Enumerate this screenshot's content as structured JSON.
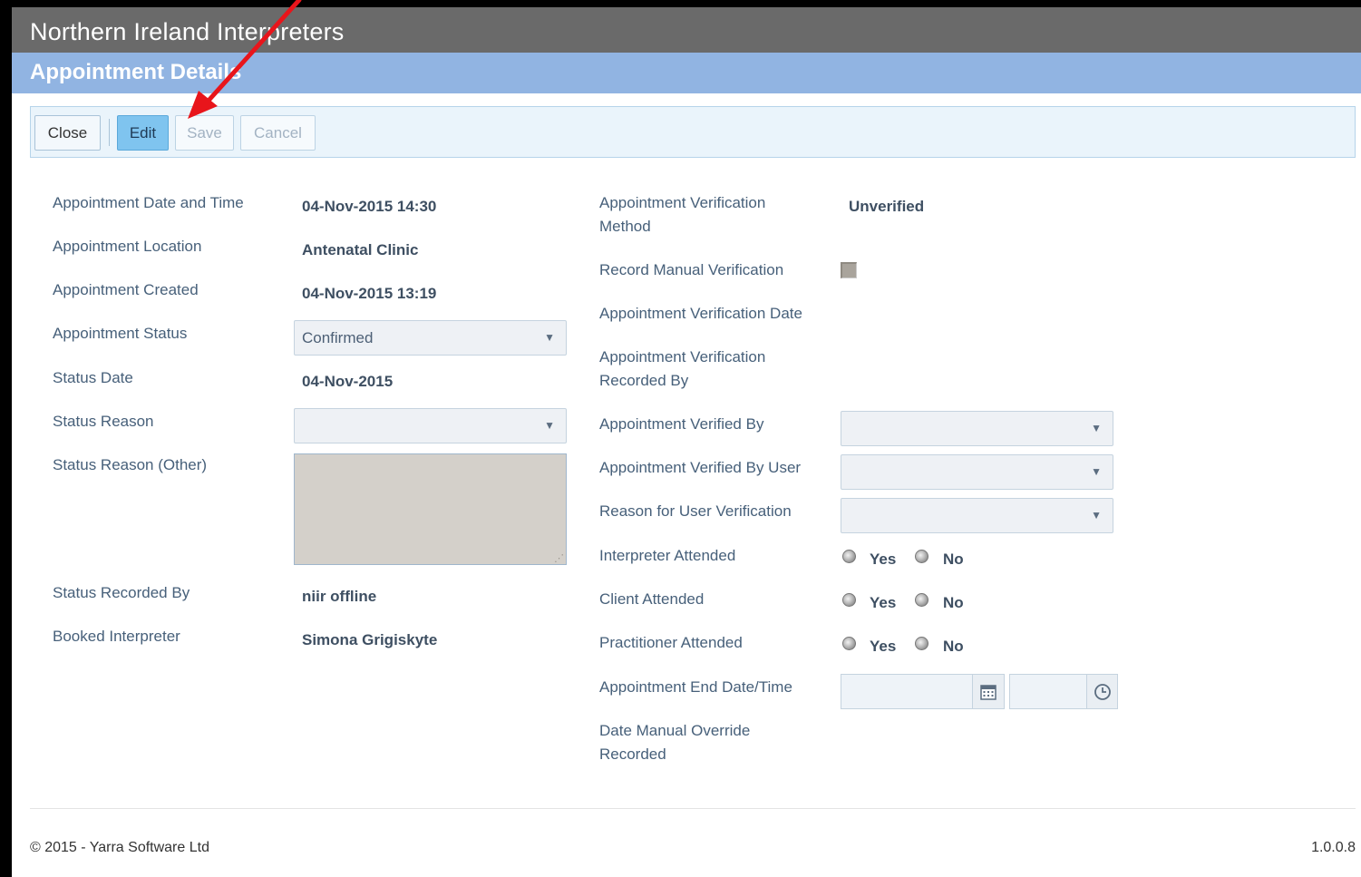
{
  "app": {
    "title": "Northern Ireland Interpreters"
  },
  "section": {
    "title": "Appointment Details"
  },
  "toolbar": {
    "close_label": "Close",
    "edit_label": "Edit",
    "save_label": "Save",
    "cancel_label": "Cancel"
  },
  "left_fields": {
    "date_time_label": "Appointment Date and Time",
    "date_time_value": "04-Nov-2015 14:30",
    "location_label": "Appointment Location",
    "location_value": "Antenatal Clinic",
    "created_label": "Appointment Created",
    "created_value": "04-Nov-2015 13:19",
    "status_label": "Appointment Status",
    "status_value": "Confirmed",
    "status_date_label": "Status Date",
    "status_date_value": "04-Nov-2015",
    "status_reason_label": "Status Reason",
    "status_reason_value": "",
    "status_reason_other_label": "Status Reason (Other)",
    "status_recorded_by_label": "Status Recorded By",
    "status_recorded_by_value": "niir offline",
    "booked_interpreter_label": "Booked Interpreter",
    "booked_interpreter_value": "Simona Grigiskyte"
  },
  "right_fields": {
    "verification_method_label_line1": "Appointment Verification",
    "verification_method_label_line2": "Method",
    "verification_method_value": "Unverified",
    "manual_verification_label": "Record Manual Verification",
    "manual_verification_checked": false,
    "verification_date_label": "Appointment Verification Date",
    "verification_recorded_by_label_line1": "Appointment Verification",
    "verification_recorded_by_label_line2": "Recorded By",
    "verified_by_label": "Appointment Verified By",
    "verified_by_user_label": "Appointment Verified By User",
    "reason_user_verification_label": "Reason for User Verification",
    "interpreter_attended_label": "Interpreter Attended",
    "client_attended_label": "Client Attended",
    "practitioner_attended_label": "Practitioner Attended",
    "yes_label": "Yes",
    "no_label": "No",
    "end_datetime_label": "Appointment End Date/Time",
    "date_manual_override_label_line1": "Date Manual Override",
    "date_manual_override_label_line2": "Recorded"
  },
  "footer": {
    "copyright": "© 2015 - Yarra Software Ltd",
    "version": "1.0.0.8"
  },
  "colors": {
    "header_bg": "#6a6a6a",
    "section_bg": "#91b4e2",
    "annotation_arrow": "#e8151b"
  }
}
